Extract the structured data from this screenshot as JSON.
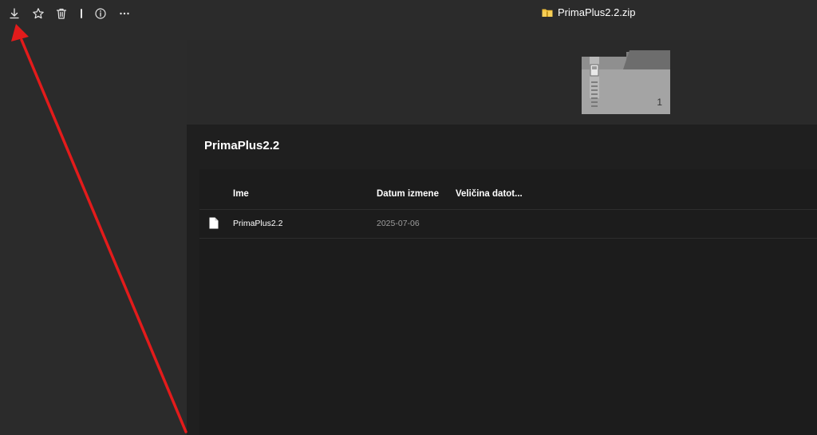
{
  "toolbar": {
    "buttons": [
      {
        "name": "download-button",
        "icon": "download-icon"
      },
      {
        "name": "favorite-button",
        "icon": "star-icon"
      },
      {
        "name": "delete-button",
        "icon": "trash-icon"
      },
      {
        "name": "info-button",
        "icon": "info-icon"
      },
      {
        "name": "more-button",
        "icon": "more-horizontal-icon"
      }
    ]
  },
  "window": {
    "title": "PrimaPlus2.2.zip",
    "title_icon": "zip-folder-icon"
  },
  "preview": {
    "item_count": "1",
    "icon": "zip-folder-thumbnail-icon"
  },
  "folder": {
    "title": "PrimaPlus2.2"
  },
  "list": {
    "columns": [
      "Ime",
      "Datum izmene",
      "Veličina datot..."
    ],
    "rows": [
      {
        "icon": "file-icon",
        "name": "PrimaPlus2.2",
        "date": "2025-07-06",
        "size": ""
      }
    ]
  },
  "annotation": {
    "type": "arrow",
    "points_to": "download-button"
  },
  "colors": {
    "background": "#2b2b2b",
    "content": "#1f1f1f",
    "hero": "#2a2a2a",
    "list_panel": "#1c1c1c",
    "text": "#ffffff",
    "text_muted": "#9d9d9d",
    "folder_yellow": "#f3c13a",
    "annotation_red": "#e31b1b"
  }
}
